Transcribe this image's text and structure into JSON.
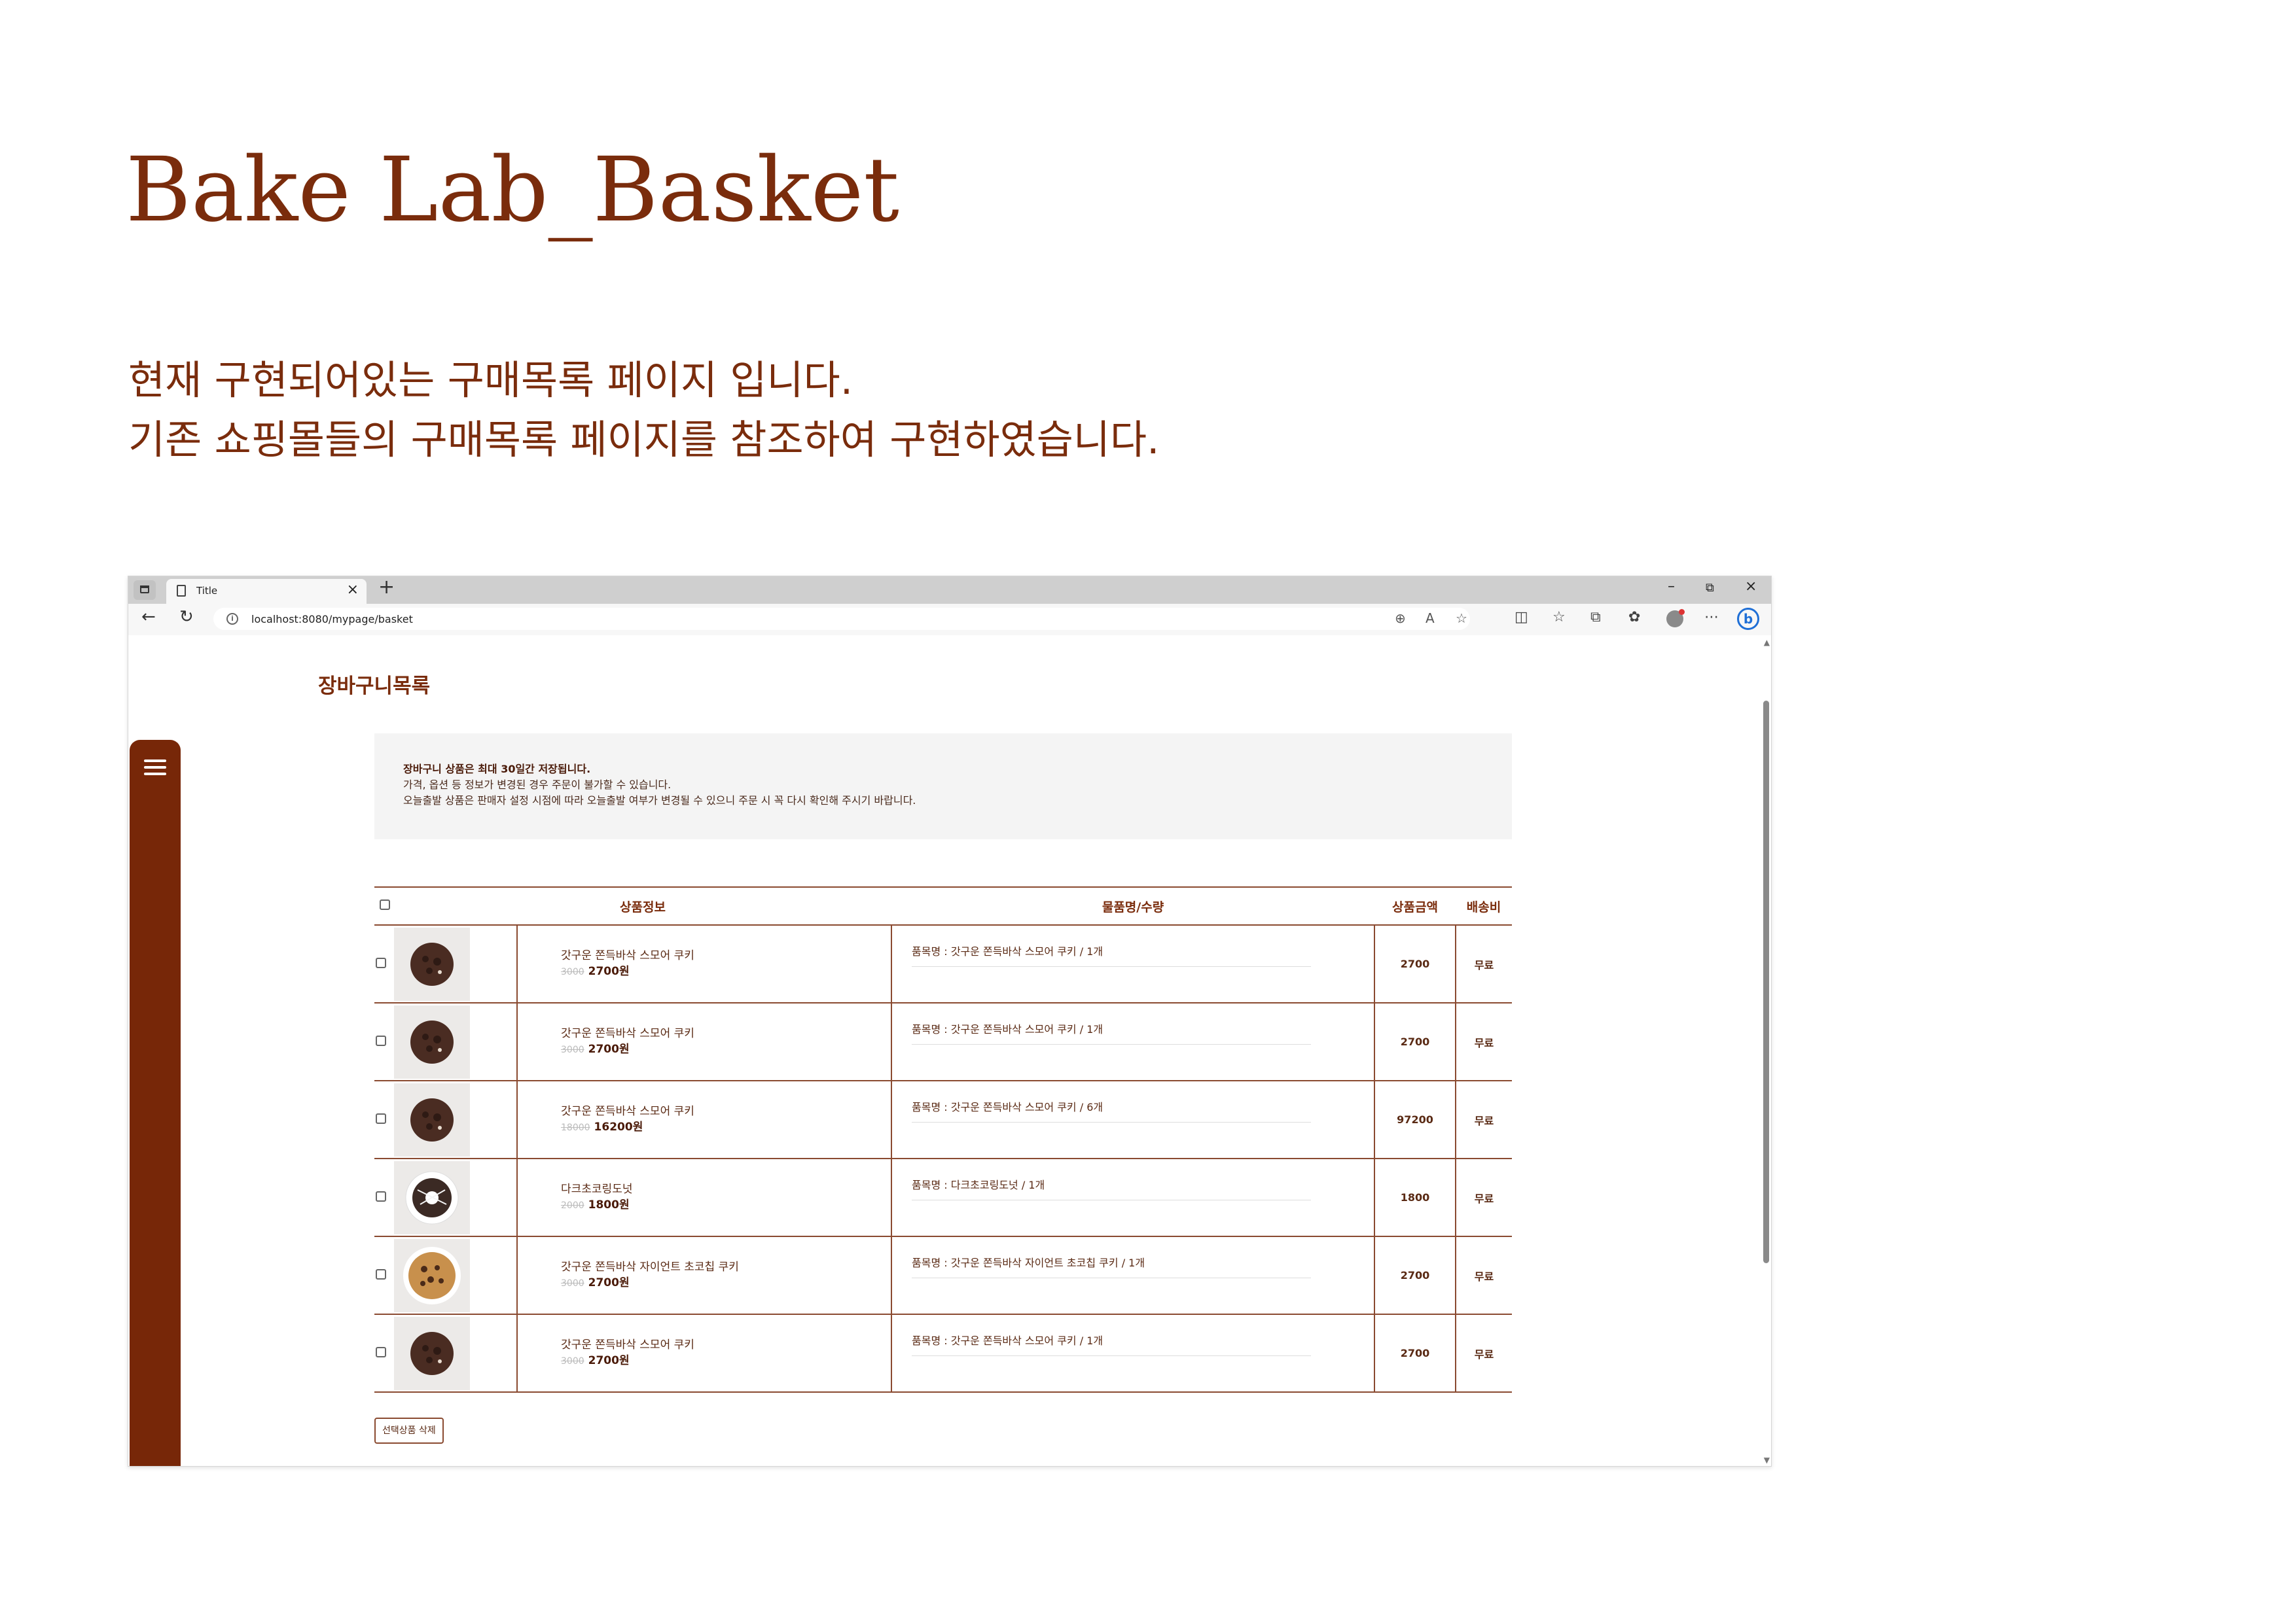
{
  "slide": {
    "title": "Bake Lab_Basket",
    "description": [
      "현재 구현되어있는 구매목록 페이지 입니다.",
      "기존 쇼핑몰들의 구매목록 페이지를 참조하여 구현하였습니다."
    ]
  },
  "browser": {
    "tab_title": "Title",
    "tab_close": "×",
    "new_tab": "+",
    "url": "localhost:8080/mypage/basket",
    "window_controls": {
      "minimize": "–",
      "restore": "⧉",
      "close": "×"
    },
    "icons": [
      "tab-switcher-icon",
      "page-icon",
      "back-icon",
      "reload-icon",
      "info-icon",
      "zoom-icon",
      "read-aloud-icon",
      "favorite-icon",
      "split-screen-icon",
      "favorites-icon",
      "collections-icon",
      "extensions-icon",
      "profile-icon",
      "more-icon",
      "bing-icon"
    ]
  },
  "page": {
    "heading": "장바구니목록",
    "notice": [
      "장바구니 상품은 최대 30일간 저장됩니다.",
      "가격, 옵션 등 정보가 변경된 경우 주문이 불가할 수 있습니다.",
      "오늘출발 상품은 판매자 설정 시점에 따라 오늘출발 여부가 변경될 수 있으니 주문 시 꼭 다시 확인해 주시기 바랍니다."
    ],
    "table": {
      "headers": {
        "product_info": "상품정보",
        "option_qty": "물품명/수량",
        "price": "상품금액",
        "shipping": "배송비"
      },
      "rows": [
        {
          "name": "갓구운 쫀득바삭 스모어 쿠키",
          "original": "3000",
          "sale": "2700원",
          "option": "품목명 : 갓구운 쫀득바삭 스모어 쿠키 / 1개",
          "price": "2700",
          "shipping": "무료",
          "image": "cookie-dark"
        },
        {
          "name": "갓구운 쫀득바삭 스모어 쿠키",
          "original": "3000",
          "sale": "2700원",
          "option": "품목명 : 갓구운 쫀득바삭 스모어 쿠키 / 1개",
          "price": "2700",
          "shipping": "무료",
          "image": "cookie-dark"
        },
        {
          "name": "갓구운 쫀득바삭 스모어 쿠키",
          "original": "18000",
          "sale": "16200원",
          "option": "품목명 : 갓구운 쫀득바삭 스모어 쿠키 / 6개",
          "price": "97200",
          "shipping": "무료",
          "image": "cookie-dark"
        },
        {
          "name": "다크초코링도넛",
          "original": "2000",
          "sale": "1800원",
          "option": "품목명 : 다크초코링도넛 / 1개",
          "price": "1800",
          "shipping": "무료",
          "image": "donut"
        },
        {
          "name": "갓구운 쫀득바삭 자이언트 초코칩 쿠키",
          "original": "3000",
          "sale": "2700원",
          "option": "품목명 : 갓구운 쫀득바삭 자이언트 초코칩 쿠키 / 1개",
          "price": "2700",
          "shipping": "무료",
          "image": "cookie-chip"
        },
        {
          "name": "갓구운 쫀득바삭 스모어 쿠키",
          "original": "3000",
          "sale": "2700원",
          "option": "품목명 : 갓구운 쫀득바삭 스모어 쿠키 / 1개",
          "price": "2700",
          "shipping": "무료",
          "image": "cookie-dark"
        }
      ]
    },
    "delete_button": "선택상품 삭제"
  },
  "colors": {
    "brand": "#7a2c0c",
    "sidebar": "#772708",
    "table_border": "#8a4a30",
    "notice_bg": "#f4f4f4"
  }
}
